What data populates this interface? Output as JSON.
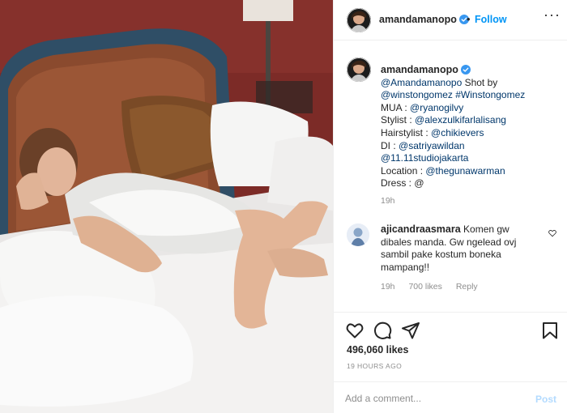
{
  "post": {
    "username": "amandamanopo",
    "verified": true,
    "follow_label": "Follow",
    "separator": "•",
    "more_label": "···"
  },
  "caption": {
    "username": "amandamanopo",
    "lines": [
      {
        "parts": [
          {
            "t": "@Amandamanopo",
            "link": true
          },
          {
            "t": " Shot by",
            "link": false
          }
        ]
      },
      {
        "parts": [
          {
            "t": "@winstongomez",
            "link": true
          },
          {
            "t": " ",
            "link": false
          },
          {
            "t": "#Winstongomez",
            "link": true
          }
        ]
      },
      {
        "parts": [
          {
            "t": "MUA : ",
            "link": false
          },
          {
            "t": "@ryanogilvy",
            "link": true
          }
        ]
      },
      {
        "parts": [
          {
            "t": "Stylist : ",
            "link": false
          },
          {
            "t": "@alexzulkifarlalisang",
            "link": true
          }
        ]
      },
      {
        "parts": [
          {
            "t": "Hairstylist : ",
            "link": false
          },
          {
            "t": "@chikievers",
            "link": true
          }
        ]
      },
      {
        "parts": [
          {
            "t": "DI : ",
            "link": false
          },
          {
            "t": "@satriyawildan",
            "link": true
          }
        ]
      },
      {
        "parts": [
          {
            "t": "@11.11studiojakarta",
            "link": true
          }
        ]
      },
      {
        "parts": [
          {
            "t": "Location : ",
            "link": false
          },
          {
            "t": "@thegunawarman",
            "link": true
          }
        ]
      },
      {
        "parts": [
          {
            "t": "Dress : @",
            "link": false
          }
        ]
      }
    ],
    "time": "19h"
  },
  "comment": {
    "username": "ajicandraasmara",
    "text_lines": [
      "Komen gw",
      "dibales manda. Gw ngelead ovj",
      "sambil pake kostum boneka",
      "mampang!!"
    ],
    "time": "19h",
    "likes": "700 likes",
    "reply_label": "Reply"
  },
  "actions": {
    "likes": "496,060 likes",
    "timestamp": "19 HOURS AGO"
  },
  "add_comment": {
    "placeholder": "Add a comment...",
    "post_label": "Post"
  },
  "colors": {
    "link": "#00376b",
    "follow": "#0095f6",
    "post_disabled": "#b3dbff",
    "verified": "#3897f0"
  },
  "icons": [
    "verified-badge-icon",
    "more-options-icon",
    "heart-icon",
    "comment-icon",
    "share-icon",
    "save-icon",
    "comment-like-heart-icon"
  ]
}
